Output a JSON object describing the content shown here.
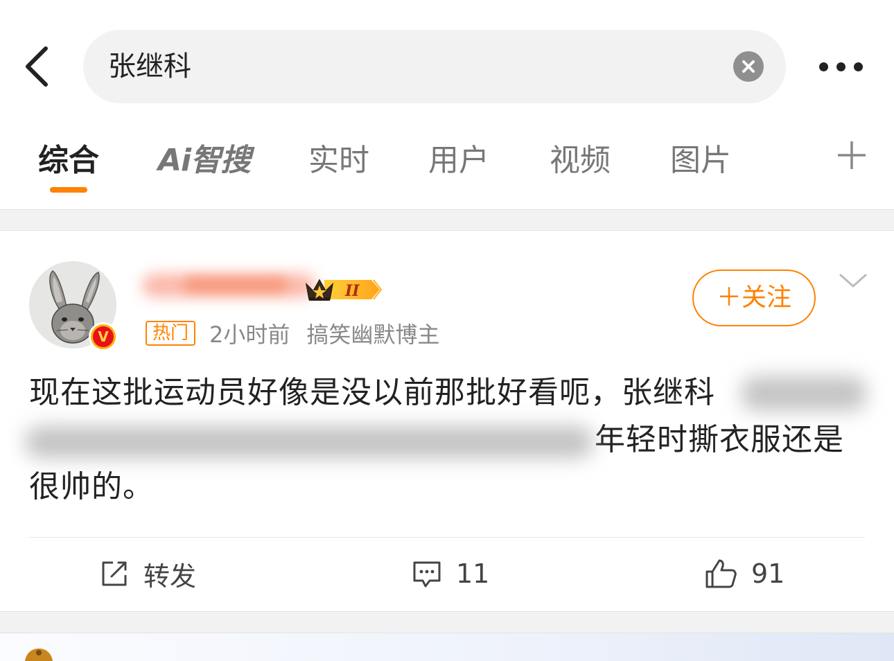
{
  "search": {
    "query": "张继科"
  },
  "tabs": [
    {
      "label": "综合",
      "active": true
    },
    {
      "label": "Ai智搜",
      "active": false
    },
    {
      "label": "实时",
      "active": false
    },
    {
      "label": "用户",
      "active": false
    },
    {
      "label": "视频",
      "active": false
    },
    {
      "label": "图片",
      "active": false
    }
  ],
  "post": {
    "hot_tag": "热门",
    "time": "2小时前",
    "author_role": "搞笑幽默博主",
    "follow_label": "＋关注",
    "vip_level": "II",
    "text": "现在这批运动员好像是没以前那批好看呃，张继科                    年轻时撕衣服还是很帅的。",
    "text_line1": "现在这批运动员好像是没以前那批好看呃，张继科",
    "text_line2": "年轻时撕衣服还是",
    "text_line3": "很帅的。",
    "actions": {
      "repost_label": "转发",
      "comments_count": "11",
      "likes_count": "91"
    }
  },
  "icons": {
    "back": "chevron-left-icon",
    "clear": "close-circle-icon",
    "more": "more-dots-icon",
    "add_tab": "plus-icon",
    "repost": "share-edit-icon",
    "comment": "comment-bubble-icon",
    "like": "thumbs-up-icon",
    "verified": "verified-v-icon",
    "vip": "crown-icon"
  },
  "colors": {
    "accent": "#ff8200",
    "verified_red": "#e8101b",
    "verified_gold": "#ffb400"
  }
}
